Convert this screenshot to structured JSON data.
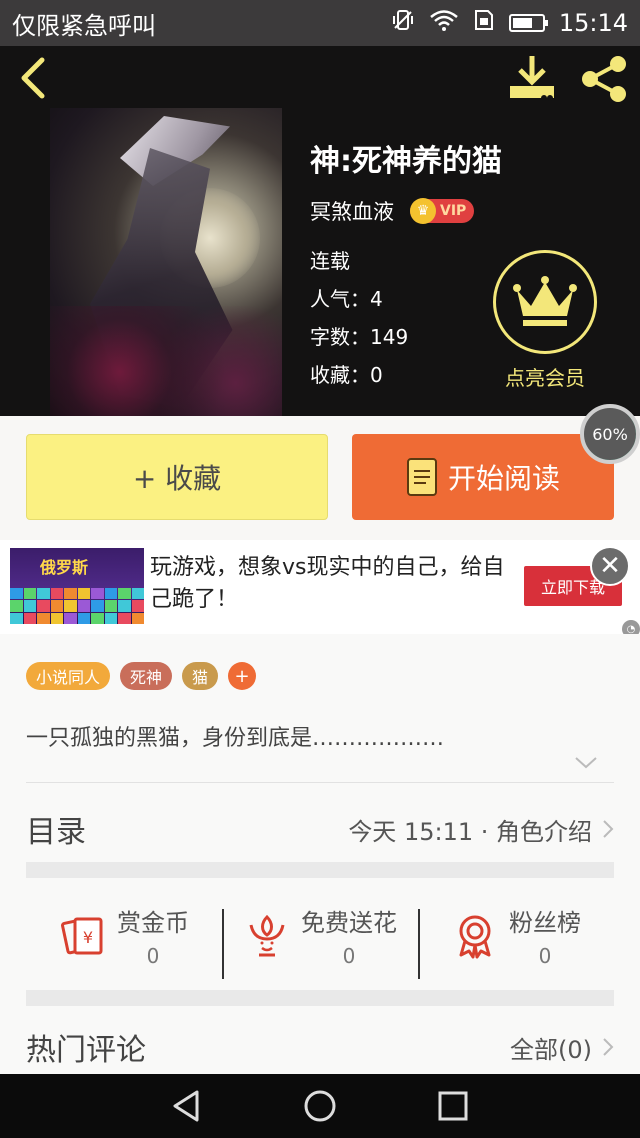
{
  "status_bar": {
    "carrier": "仅限紧急呼叫",
    "time": "15:14",
    "battery_level": 0.7
  },
  "header": {
    "icons": [
      "back-icon",
      "download-icon",
      "share-icon"
    ]
  },
  "book": {
    "title": "神:死神养的猫",
    "author": "冥煞血液",
    "vip_label": "VIP",
    "status": "连载",
    "popularity_label": "人气：",
    "popularity": "4",
    "word_count_label": "字数：",
    "word_count": "149",
    "favorites_label": "收藏：",
    "favorites": "0",
    "member_label": "点亮会员"
  },
  "actions": {
    "favorite_label": "+ 收藏",
    "read_label": "开始阅读",
    "progress_text": "60%",
    "progress_value": 0.6
  },
  "ad": {
    "thumb_logo": "俄罗斯",
    "text": "玩游戏，想象vs现实中的自己，给自己跪了！",
    "cta": "立即下载",
    "close_symbol": "✕"
  },
  "tags": [
    {
      "label": "小说同人",
      "color": "#f2a93b"
    },
    {
      "label": "死神",
      "color": "#c96e5a"
    },
    {
      "label": "猫",
      "color": "#c99a4c"
    }
  ],
  "tag_add_symbol": "+",
  "synopsis": "一只孤独的黑猫，身份到底是………………",
  "toc": {
    "title": "目录",
    "meta": "今天 15:11 · 角色介绍"
  },
  "stats": [
    {
      "label": "赏金币",
      "value": "0",
      "icon": "red-envelope-icon"
    },
    {
      "label": "免费送花",
      "value": "0",
      "icon": "flower-icon"
    },
    {
      "label": "粉丝榜",
      "value": "0",
      "icon": "medal-icon"
    }
  ],
  "comments": {
    "title": "热门评论",
    "all_label": "全部(0)"
  },
  "colors": {
    "accent_orange": "#ef6b35",
    "fav_yellow": "#fbf182",
    "member_gold": "#f3e77a",
    "icon_red": "#d8402f"
  }
}
